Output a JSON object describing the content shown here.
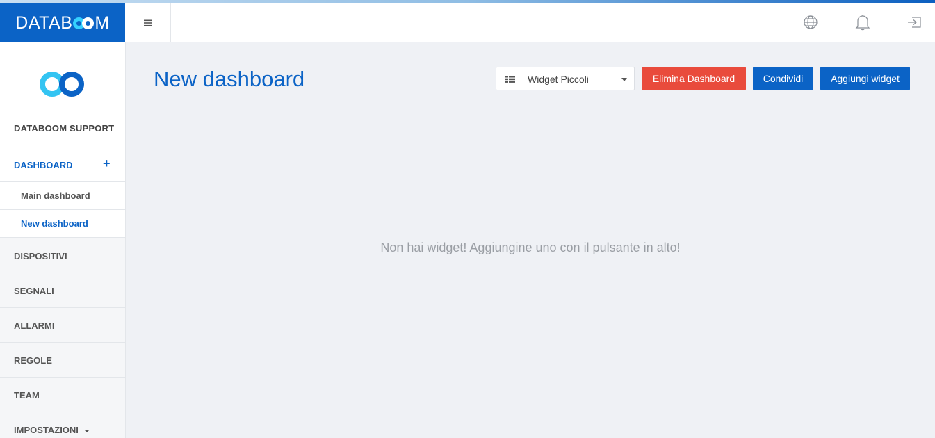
{
  "brand": {
    "logo_prefix": "DATAB",
    "logo_suffix": "M",
    "accent": "#0b63c6",
    "danger": "#e94b3c"
  },
  "topbar": {
    "menu_icon": "hamburger-icon",
    "icons": [
      "globe-icon",
      "bell-icon",
      "logout-icon"
    ]
  },
  "sidebar": {
    "user_name": "DATABOOM SUPPORT",
    "dashboard_label": "DASHBOARD",
    "dashboard_add": "+",
    "dashboards": [
      {
        "label": "Main dashboard",
        "active": false
      },
      {
        "label": "New dashboard",
        "active": true
      }
    ],
    "items": [
      {
        "label": "DISPOSITIVI"
      },
      {
        "label": "SEGNALI"
      },
      {
        "label": "ALLARMI"
      },
      {
        "label": "REGOLE"
      },
      {
        "label": "TEAM"
      },
      {
        "label": "IMPOSTAZIONI"
      }
    ]
  },
  "main": {
    "title": "New dashboard",
    "widget_size_select": "Widget Piccoli",
    "delete_button": "Elimina Dashboard",
    "share_button": "Condividi",
    "add_widget_button": "Aggiungi widget",
    "empty_message": "Non hai widget! Aggiungine uno con il pulsante in alto!"
  }
}
